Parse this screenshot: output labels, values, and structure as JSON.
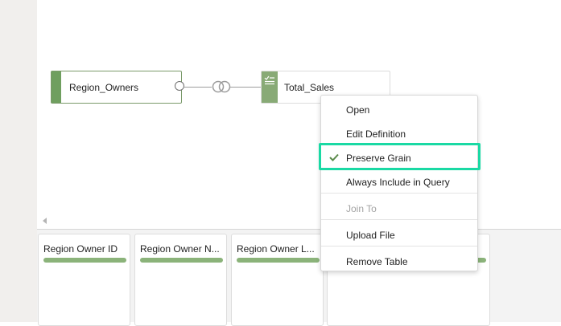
{
  "diagram": {
    "source_node": {
      "label": "Region_Owners"
    },
    "target_node": {
      "label": "Total_Sales"
    },
    "icons": {
      "join": "join-venn-icon",
      "table": "calculated-table-icon",
      "scroll": "scroll-left-icon"
    }
  },
  "columns": [
    {
      "title": "Region Owner ID"
    },
    {
      "title": "Region Owner N..."
    },
    {
      "title": "Region Owner L..."
    },
    {
      "title": ""
    }
  ],
  "context_menu": {
    "items": [
      {
        "label": "Open",
        "enabled": true
      },
      {
        "label": "Edit Definition",
        "enabled": true
      },
      {
        "label": "Preserve Grain",
        "enabled": true,
        "checked": true
      },
      {
        "label": "Always Include in Query",
        "enabled": true
      },
      {
        "label": "Join To",
        "enabled": false
      },
      {
        "label": "Upload File",
        "enabled": true
      },
      {
        "label": "Remove Table",
        "enabled": true
      }
    ]
  },
  "colors": {
    "accent_green": "#6f9f5f",
    "bar_green": "#8bb37a",
    "focus_highlight": "#1ad9a4"
  }
}
